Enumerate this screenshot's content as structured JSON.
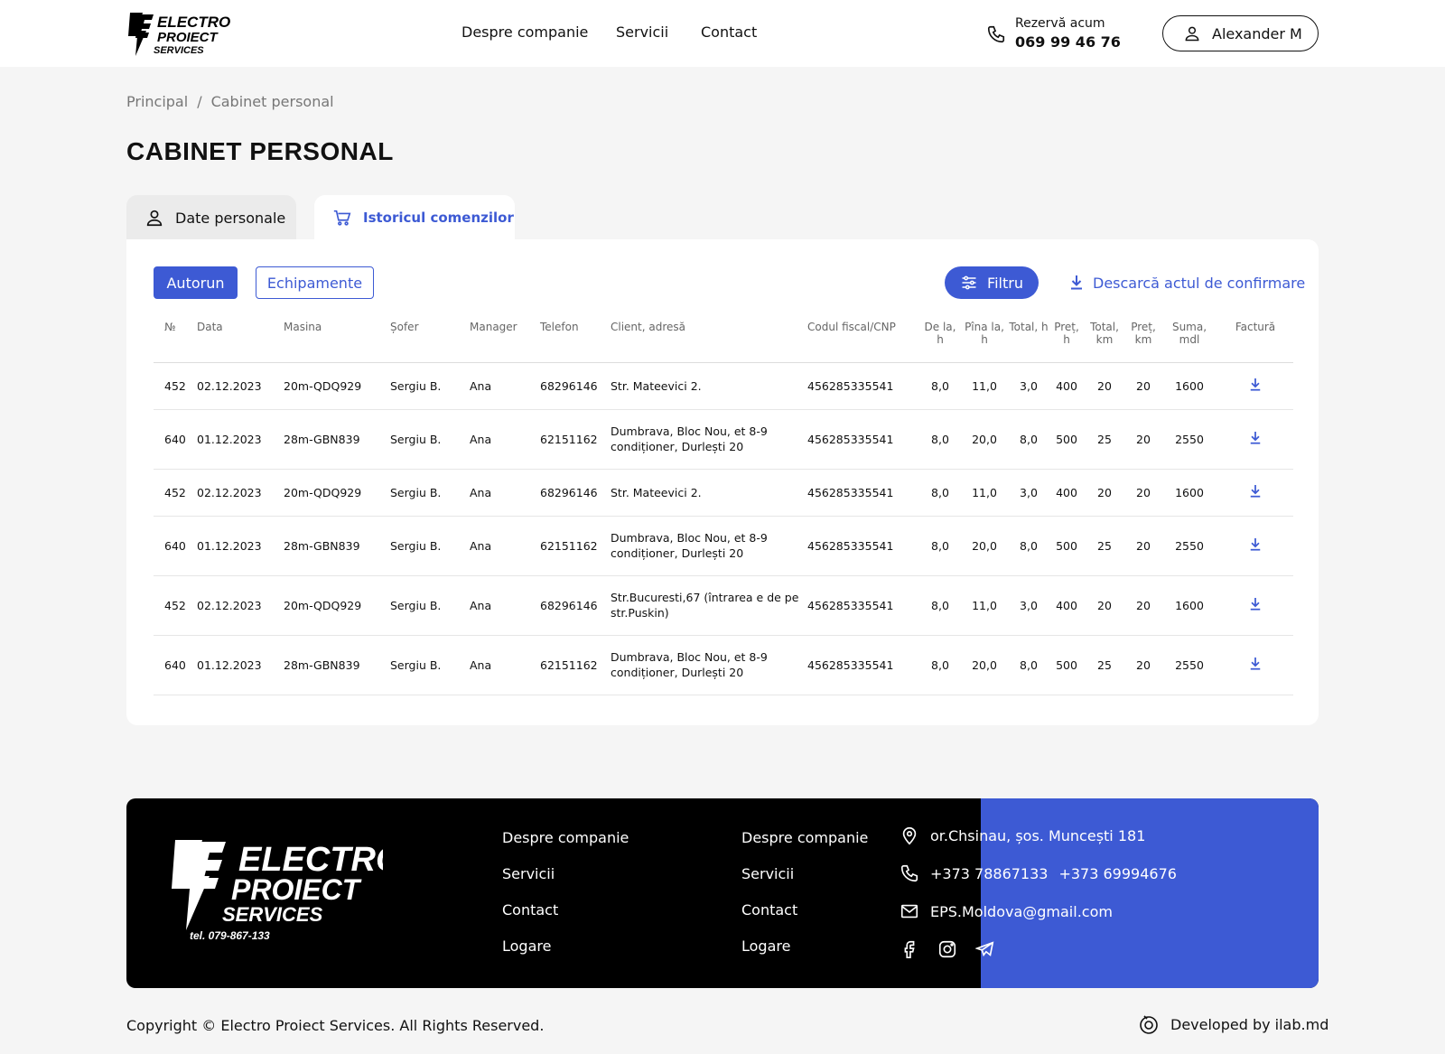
{
  "header": {
    "logo_alt": "Electro Proiect Services",
    "nav": [
      "Despre companie",
      "Servicii",
      "Contact"
    ],
    "phone_label": "Rezervă acum",
    "phone_number": "069 99 46 76",
    "user_name": "Alexander M"
  },
  "breadcrumb": {
    "home": "Principal",
    "separator": "/",
    "current": "Cabinet personal"
  },
  "page_title": "CABINET PERSONAL",
  "tabs": {
    "personal": "Date personale",
    "history": "Istoricul comenzilor"
  },
  "toolbar": {
    "autorun": "Autorun",
    "equipment": "Echipamente",
    "filter": "Filtru",
    "download_act": "Descarcă actul de confirmare"
  },
  "table": {
    "headers": [
      "№",
      "Data",
      "Masina",
      "Șofer",
      "Manager",
      "Telefon",
      "Client, adresă",
      "Codul fiscal/CNP",
      "De la, h",
      "Pîna la, h",
      "Total, h",
      "Preț, h",
      "Total, km",
      "Preț, km",
      "Suma, mdl",
      "Factură"
    ],
    "rows": [
      [
        "452",
        "02.12.2023",
        "20m-QDQ929",
        "Sergiu B.",
        "Ana",
        "68296146",
        "Str. Mateevici 2.",
        "456285335541",
        "8,0",
        "11,0",
        "3,0",
        "400",
        "20",
        "20",
        "1600"
      ],
      [
        "640",
        "01.12.2023",
        "28m-GBN839",
        "Sergiu B.",
        "Ana",
        "62151162",
        "Dumbrava, Bloc Nou, et 8-9 condiționer, Durlești 20",
        "456285335541",
        "8,0",
        "20,0",
        "8,0",
        "500",
        "25",
        "20",
        "2550"
      ],
      [
        "452",
        "02.12.2023",
        "20m-QDQ929",
        "Sergiu B.",
        "Ana",
        "68296146",
        "Str. Mateevici 2.",
        "456285335541",
        "8,0",
        "11,0",
        "3,0",
        "400",
        "20",
        "20",
        "1600"
      ],
      [
        "640",
        "01.12.2023",
        "28m-GBN839",
        "Sergiu B.",
        "Ana",
        "62151162",
        "Dumbrava, Bloc Nou, et 8-9 condiționer, Durlești 20",
        "456285335541",
        "8,0",
        "20,0",
        "8,0",
        "500",
        "25",
        "20",
        "2550"
      ],
      [
        "452",
        "02.12.2023",
        "20m-QDQ929",
        "Sergiu B.",
        "Ana",
        "68296146",
        "Str.Bucuresti,67 (întrarea e de pe str.Puskin)",
        "456285335541",
        "8,0",
        "11,0",
        "3,0",
        "400",
        "20",
        "20",
        "1600"
      ],
      [
        "640",
        "01.12.2023",
        "28m-GBN839",
        "Sergiu B.",
        "Ana",
        "62151162",
        "Dumbrava, Bloc Nou, et 8-9 condiționer, Durlești 20",
        "456285335541",
        "8,0",
        "20,0",
        "8,0",
        "500",
        "25",
        "20",
        "2550"
      ]
    ]
  },
  "footer": {
    "col1": [
      "Despre companie",
      "Servicii",
      "Contact",
      "Logare"
    ],
    "col2": [
      "Despre companie",
      "Servicii",
      "Contact",
      "Logare"
    ],
    "address": "or.Chsinau, șos. Muncești 181",
    "phone1": "+373 78867133",
    "phone2": "+373 69994676",
    "email": "EPS.Moldova@gmail.com",
    "logo_tel": "tel. 079-867-133"
  },
  "copyright": "Copyright © Electro Proiect Services. All Rights Reserved.",
  "developer": "Developed by ilab.md",
  "colors": {
    "accent": "#3d5ad4",
    "footer_bg": "#000000",
    "page_bg": "#f5f5f5"
  }
}
